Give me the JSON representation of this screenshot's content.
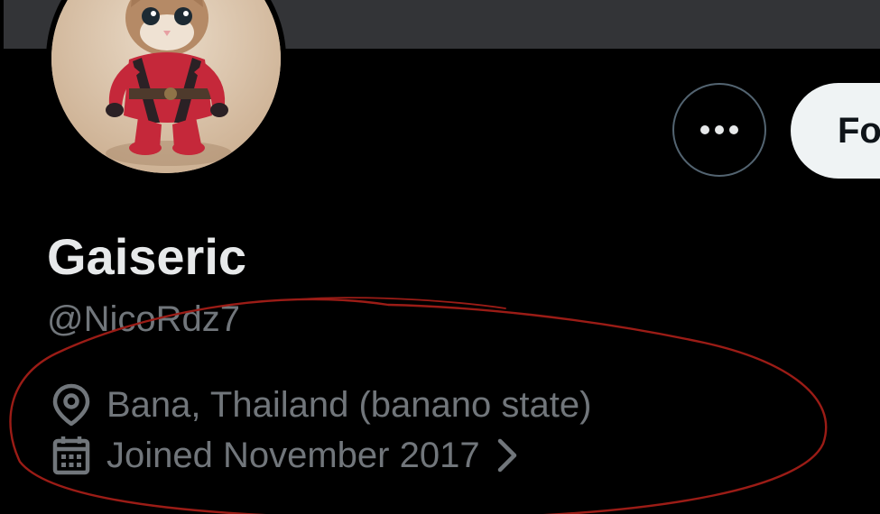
{
  "profile": {
    "display_name": "Gaiseric",
    "handle": "@NicoRdz7",
    "location": "Bana, Thailand (banano state)",
    "joined": "Joined November 2017"
  },
  "actions": {
    "follow_label": "Follow"
  },
  "icons": {
    "more": "more-horizontal-icon",
    "location": "location-pin-icon",
    "joined": "calendar-icon",
    "chevron": "chevron-right-icon"
  },
  "colors": {
    "background": "#000000",
    "banner": "#333437",
    "primary_text": "#e7e9ea",
    "secondary_text": "#71767b",
    "button_border": "#536471",
    "follow_button_bg": "#eff3f4",
    "follow_button_text": "#0f1419",
    "annotation_ink": "#9b1c16"
  }
}
